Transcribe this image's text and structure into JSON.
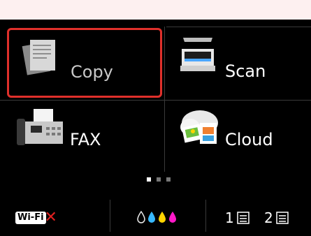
{
  "menu": {
    "copy_label": "Copy",
    "scan_label": "Scan",
    "fax_label": "FAX",
    "cloud_label": "Cloud"
  },
  "pager": {
    "total": 3,
    "active_index": 0
  },
  "status": {
    "wifi_label": "Wi-Fi",
    "wifi_state": "disconnected",
    "ink_colors": [
      "#e8e8e8",
      "#38b8ff",
      "#ffd400",
      "#ff19c8"
    ],
    "paper_slots": [
      {
        "label": "1"
      },
      {
        "label": "2"
      }
    ]
  },
  "colors": {
    "highlight": "#e0302b",
    "screen_bg": "#000000"
  }
}
